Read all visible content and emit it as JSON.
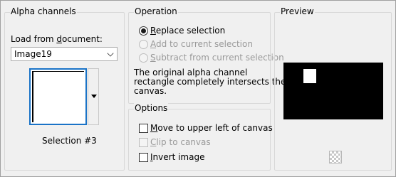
{
  "alpha": {
    "title": "Alpha channels",
    "load_pre": "Load from ",
    "load_u": "d",
    "load_post": "ocument:",
    "document_value": "Image19",
    "selection_label": "Selection #3"
  },
  "operation": {
    "title": "Operation",
    "options": [
      {
        "pre": "",
        "u": "R",
        "post": "eplace selection",
        "selected": true,
        "enabled": true
      },
      {
        "pre": "",
        "u": "A",
        "post": "dd to current selection",
        "selected": false,
        "enabled": false
      },
      {
        "pre": "",
        "u": "S",
        "post": "ubtract from current selection",
        "selected": false,
        "enabled": false
      }
    ],
    "message": [
      "The original alpha channel",
      "rectangle completely intersects the",
      "canvas."
    ]
  },
  "options": {
    "title": "Options",
    "items": [
      {
        "pre": "",
        "u": "M",
        "post": "ove to upper left of canvas",
        "checked": false,
        "enabled": true
      },
      {
        "pre": "",
        "u": "C",
        "post": "lip to canvas",
        "checked": false,
        "enabled": false
      },
      {
        "pre": "",
        "u": "I",
        "post": "nvert image",
        "checked": false,
        "enabled": true
      }
    ]
  },
  "preview": {
    "title": "Preview",
    "selection_fill": "#ffffff",
    "background": "#000000"
  },
  "colors": {
    "focus_border": "#1a73c7",
    "disabled_text": "#9a9a9a"
  }
}
